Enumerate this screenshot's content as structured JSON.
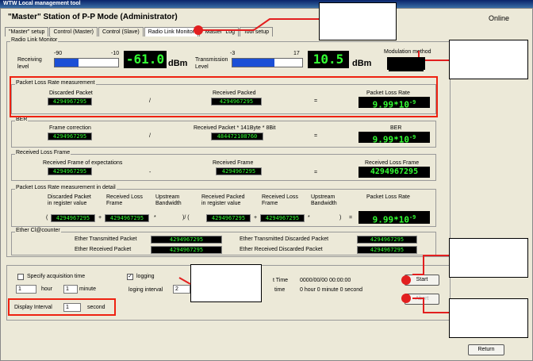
{
  "app": {
    "title": "WTW Local management tool"
  },
  "header": {
    "station": "\"Master\" Station of P-P Mode (Administrator)",
    "status": "Online"
  },
  "tabs": [
    "\"Master\" setup",
    "Control (Master)",
    "Control (Slave)",
    "Radio Link Monitor",
    "\"Master\" Log",
    "Tool setup"
  ],
  "radio_link": {
    "title": "Radio Link Monitor",
    "receiving_label_1": "Receiving",
    "receiving_label_2": "level",
    "rx_scale_min": "-90",
    "rx_scale_max": "-10",
    "rx_bar_fraction": 0.37,
    "rx_value": "-61.0",
    "rx_unit": "dBm",
    "tx_label_1": "Transmission",
    "tx_label_2": "Level",
    "tx_scale_min": "-3",
    "tx_scale_max": "17",
    "tx_bar_fraction": 0.6,
    "tx_value": "10.5",
    "tx_unit": "dBm",
    "modulation_label": "Modulation method"
  },
  "plr": {
    "title": "Packet Loss Rate measurement",
    "discarded_label": "Discarded Packet",
    "discarded_value": "4294967295",
    "received_label": "Received Packed",
    "received_value": "4294967295",
    "rate_label": "Packet Loss Rate",
    "rate_value": "9.99*10",
    "rate_exp": "-9",
    "slash": "/",
    "equals": "="
  },
  "ber": {
    "title": "BER",
    "frame_label": "Frame correction",
    "frame_value": "4294967295",
    "received_label": "Received Packet * 141Byte * 8Bit",
    "received_value": "484472108760",
    "ber_label": "BER",
    "ber_value": "9.99*10",
    "ber_exp": "-9",
    "slash": "/",
    "equals": "="
  },
  "rlf": {
    "title": "Received Loss Frame",
    "expect_label": "Received Frame of expectations",
    "expect_value": "4294967295",
    "recv_label": "Received Frame",
    "recv_value": "4294967295",
    "loss_label": "Received Loss Frame",
    "loss_value": "4294967295",
    "minus": "-",
    "equals": "="
  },
  "detail": {
    "title": "Packet Loss Rate measurement in detail",
    "h1": "Discarded Packet",
    "h1b": "in register value",
    "h2": "Received Loss",
    "h2b": "Frame",
    "h3": "Upstream",
    "h3b": "Bandwidth",
    "h4": "Received Packed",
    "h4b": "in register value",
    "h5": "Received Loss",
    "h5b": "Frame",
    "h6": "Upstream",
    "h6b": "Bandwidth",
    "h7": "Packet Loss Rate",
    "v1": "4294967295",
    "v2": "4294967295",
    "v4": "4294967295",
    "v5": "4294967295",
    "rate_value": "9.99*10",
    "rate_exp": "-9",
    "open1": "(",
    "plus1": "+",
    "star1": "*",
    "close_div": ")/ (",
    "plus2": "+",
    "star2": "*",
    "close2": ")",
    "equals": "="
  },
  "ether": {
    "title": "Ether Cl@counter",
    "tx_label": "Ether Transmitted Packet",
    "tx_value": "4294967295",
    "rx_label": "Ether Received Packet",
    "rx_value": "4294967295",
    "txd_label": "Ether Transmitted Discarded Packet",
    "txd_value": "4294967295",
    "rxd_label": "Ether Received Discarded Packet",
    "rxd_value": "4294967295"
  },
  "bottom": {
    "specify_label": "Specify acquisition time",
    "hour_value": "1",
    "hour_label": "hour",
    "minute_value": "1",
    "minute_label": "minute",
    "display_interval_label": "Display Interval",
    "display_interval_value": "1",
    "second_label": "second",
    "logging_label": "logging",
    "logging_interval_label": "loging interval",
    "logging_interval_value": "2",
    "start_time_label": "t Time",
    "start_time_value": "0000/00/00 00:00:00",
    "time_label": "time",
    "time_value": "0 hour 0 minute 0 second",
    "start_button": "Start",
    "abort_button": "Abort",
    "return_button": "Return",
    "check_mark": "✓"
  },
  "colors": {
    "annotation": "#e21f1f",
    "lcd_text": "#33ff33",
    "bar_fill": "#1b4fd6"
  }
}
